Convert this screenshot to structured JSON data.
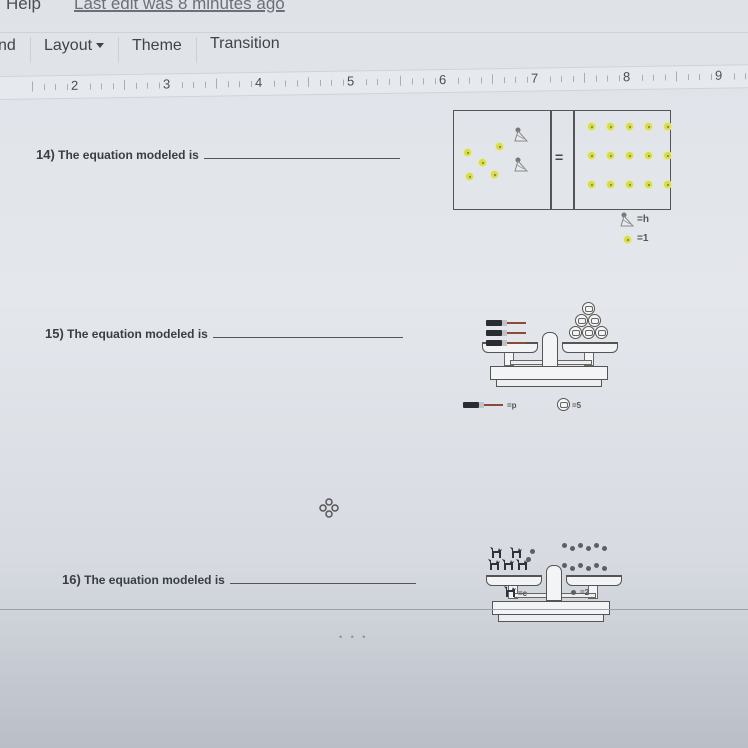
{
  "menu": {
    "help_label": "Help",
    "last_edit_text": "Last edit was 8 minutes ago"
  },
  "toolbar": {
    "background_partial": "nd",
    "layout_label": "Layout",
    "theme_label": "Theme",
    "transition_label": "Transition"
  },
  "ruler": {
    "numbers": [
      "2",
      "3",
      "4",
      "5",
      "6",
      "7",
      "8",
      "9"
    ]
  },
  "questions": [
    {
      "number": "14)",
      "prompt": "The equation modeled is",
      "model": {
        "type": "equation-mat",
        "left": {
          "hats": 2,
          "ones": 5
        },
        "right": {
          "ones": 15
        },
        "equals_sign": "=",
        "legend": [
          {
            "icon": "party-hat-icon",
            "text": "=h"
          },
          {
            "icon": "yellow-dot-icon",
            "text": "=1"
          }
        ]
      }
    },
    {
      "number": "15)",
      "prompt": "The equation modeled is",
      "model": {
        "type": "balance-scale",
        "left": {
          "paintbrushes": 3
        },
        "right": {
          "weights": 6
        },
        "legend": [
          {
            "icon": "paintbrush-icon",
            "text": "=p"
          },
          {
            "icon": "weight-icon",
            "text": "=5"
          }
        ]
      }
    },
    {
      "number": "16)",
      "prompt": "The equation modeled is",
      "model": {
        "type": "balance-scale",
        "left": {
          "cats": 5,
          "pebbles": 2
        },
        "right": {
          "pebbles": 12
        },
        "legend": [
          {
            "icon": "cat-icon",
            "text": "=c"
          },
          {
            "icon": "pebble-icon",
            "text": "=2"
          }
        ]
      }
    }
  ],
  "notes": {
    "handle_glyph": "• • •"
  }
}
